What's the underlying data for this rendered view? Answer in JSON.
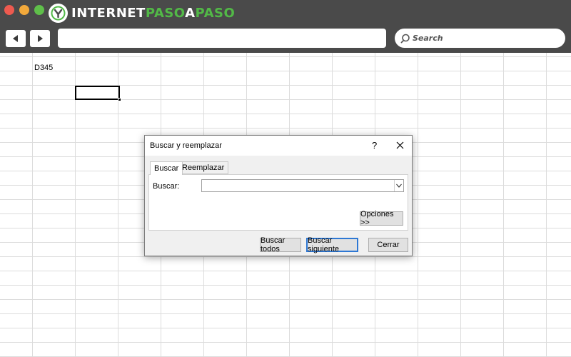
{
  "window": {
    "logo_text_1": "INTERNET",
    "logo_text_2": "PASO",
    "logo_text_3": "A",
    "logo_text_4": "PASO",
    "controls": [
      "close",
      "minimize",
      "maximize"
    ]
  },
  "toolbar": {
    "back_icon": "arrow-left-icon",
    "forward_icon": "arrow-right-icon",
    "address_value": "",
    "search_label": "Search"
  },
  "sheet": {
    "cell_text": "D345"
  },
  "dialog": {
    "title": "Buscar y reemplazar",
    "help": "?",
    "close_icon": "close-icon",
    "tabs": [
      {
        "label": "Buscar",
        "active": true
      },
      {
        "label": "Reemplazar",
        "active": false
      }
    ],
    "find_label": "Buscar:",
    "find_value": "",
    "options_button": "Opciones >>",
    "buttons": {
      "find_all": "Buscar todos",
      "find_next": "Buscar siguiente",
      "close": "Cerrar"
    }
  },
  "colors": {
    "chrome": "#4a4a4a",
    "brand_green": "#52b947",
    "accent_blue": "#2e78d4"
  }
}
